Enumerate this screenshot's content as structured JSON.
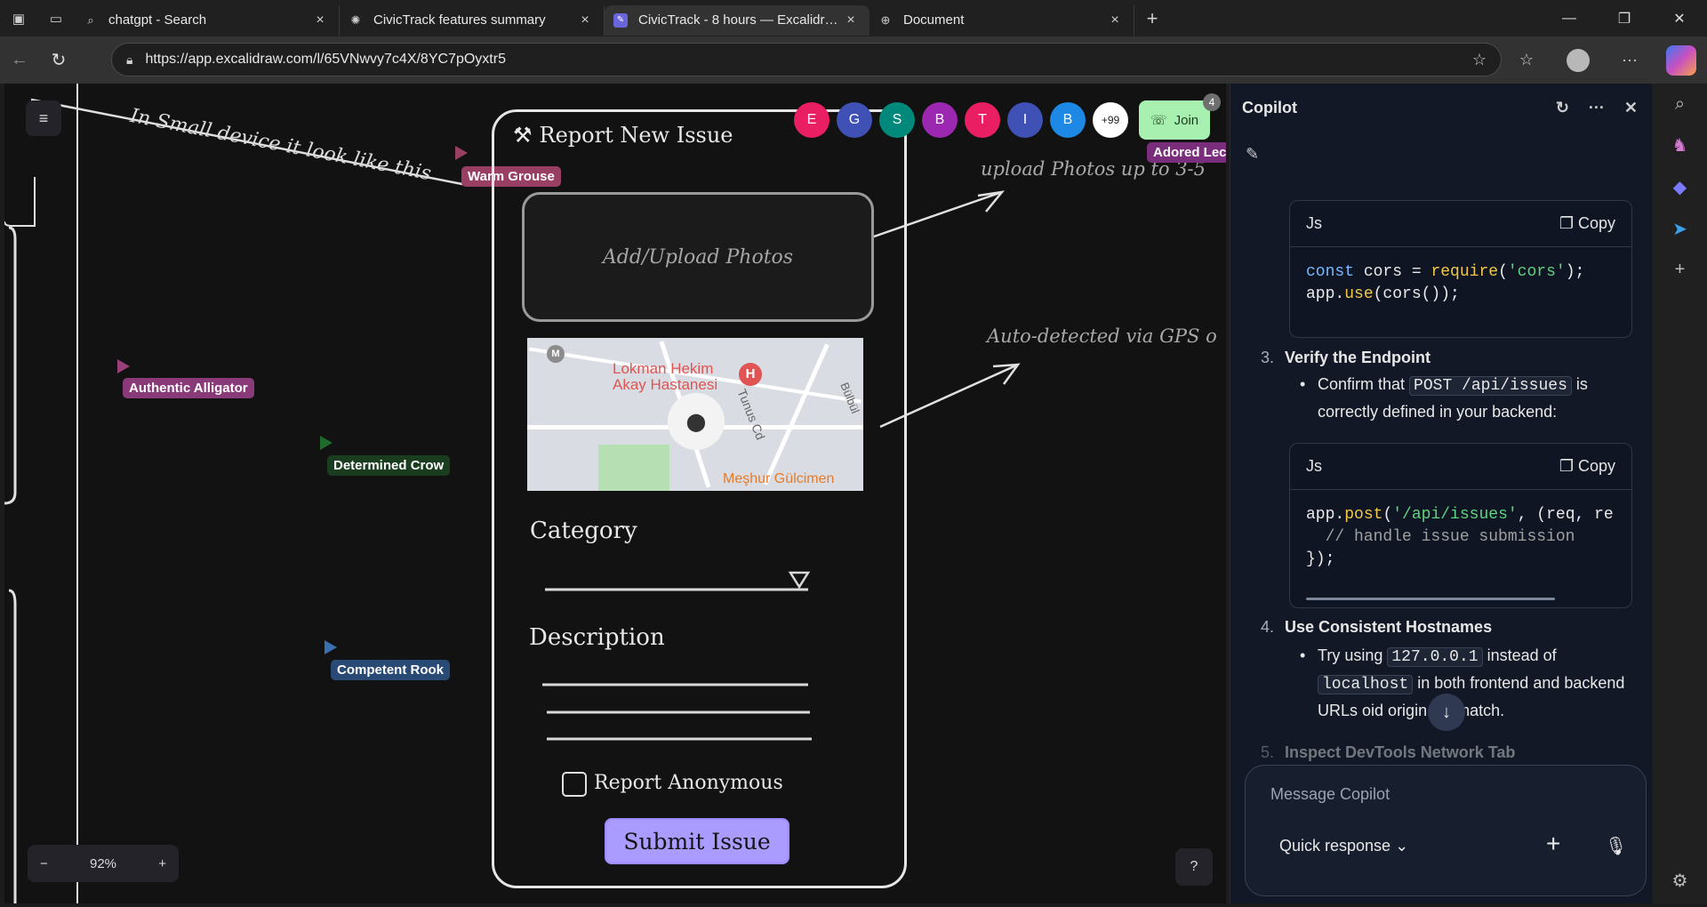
{
  "tabs": [
    {
      "title": "chatgpt - Search",
      "icon": "search-icon"
    },
    {
      "title": "CivicTrack features summary",
      "icon": "chatgpt-icon"
    },
    {
      "title": "CivicTrack - 8 hours — Excalidraw",
      "icon": "excalidraw-icon"
    },
    {
      "title": "Document",
      "icon": "globe-icon"
    }
  ],
  "address": {
    "url": "https://app.excalidraw.com/l/65VNwvy7c4X/8YC7pOyxtr5"
  },
  "canvas": {
    "note_small": "In Small device it look like this",
    "note_upload": "upload Photos up to 3-5",
    "note_gps": "Auto-detected via GPS o",
    "collaborators": [
      {
        "name": "Warm Grouse",
        "color": "#9a3f64"
      },
      {
        "name": "Authentic Alligator",
        "color": "#8a3a78"
      },
      {
        "name": "Determined Crow",
        "color": "#1a3d1f"
      },
      {
        "name": "Competent Rook",
        "color": "#284a74"
      },
      {
        "name": "Adored Lec",
        "color": "#7a2d7a"
      }
    ],
    "avatars": [
      {
        "letter": "E",
        "color": "#e91e63"
      },
      {
        "letter": "G",
        "color": "#3f51b5"
      },
      {
        "letter": "S",
        "color": "#00897b"
      },
      {
        "letter": "B",
        "color": "#9c27b0"
      },
      {
        "letter": "T",
        "color": "#e91e63"
      },
      {
        "letter": "I",
        "color": "#3f51b5"
      },
      {
        "letter": "B",
        "color": "#1e88e5"
      },
      {
        "letter": "+99",
        "color": "#ffffff"
      }
    ],
    "join_label": "Join",
    "join_badge": "4",
    "zoom": "92%",
    "form": {
      "title": "Report New Issue",
      "upload_label": "Add/Upload Photos",
      "map_poi": "Lokman Hekim Akay Hastanesi",
      "map_place": "Meşhur Gülcimen",
      "map_street": "Tunus Cd",
      "map_street2": "Bülbül",
      "category_label": "Category",
      "description_label": "Description",
      "anonymous_label": "Report Anonymous",
      "submit_label": "Submit Issue"
    }
  },
  "copilot": {
    "title": "Copilot",
    "code1_lang": "Js",
    "copy_label": "Copy",
    "code1_line1_a": "const",
    "code1_line1_b": " cors = ",
    "code1_line1_c": "require",
    "code1_line1_d": "(",
    "code1_line1_e": "'cors'",
    "code1_line1_f": ");",
    "code1_line2_a": "app.",
    "code1_line2_b": "use",
    "code1_line2_c": "(cors());",
    "step3_num": "3.",
    "step3_title": "Verify the Endpoint",
    "step3_bullet_a": "Confirm that ",
    "step3_bullet_code": "POST /api/issues",
    "step3_bullet_b": " is correctly defined in your backend:",
    "code2_lang": "Js",
    "code2_line1_a": "app.",
    "code2_line1_b": "post",
    "code2_line1_c": "(",
    "code2_line1_d": "'/api/issues'",
    "code2_line1_e": ", (req, re",
    "code2_line2": "  // handle issue submission",
    "code2_line3": "});",
    "step4_num": "4.",
    "step4_title": "Use Consistent Hostnames",
    "step4_a": "Try using ",
    "step4_code1": "127.0.0.1",
    "step4_b": " instead of ",
    "step4_code2": "localhost",
    "step4_c": " in both frontend and backend URLs",
    "step4_d": "oid origin mismatch.",
    "step5_num": "5.",
    "step5_title": "Inspect DevTools Network Tab",
    "composer_placeholder": "Message Copilot",
    "quick_response": "Quick response"
  }
}
